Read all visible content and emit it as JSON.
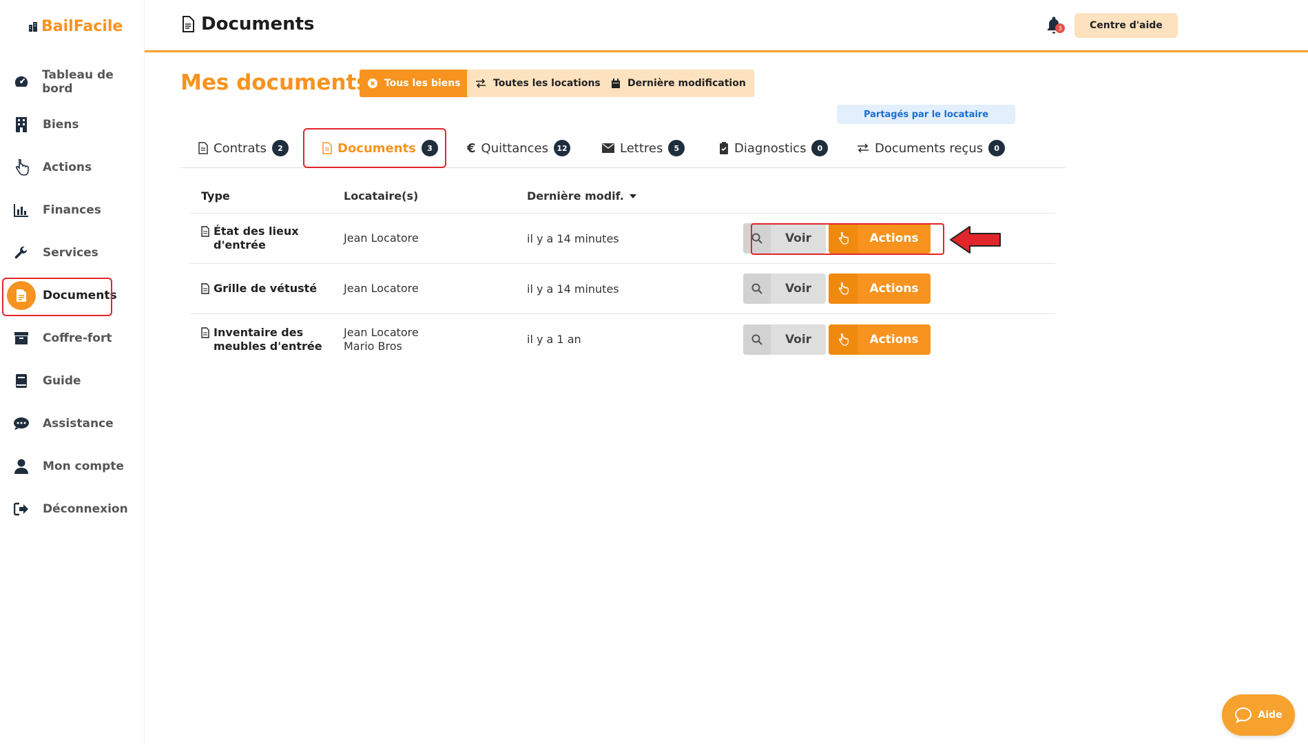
{
  "app": {
    "logo": "BailFacile"
  },
  "colors": {
    "accent": "#f7931e",
    "annotation": "#e0252b",
    "badge": "#1f2d3d"
  },
  "sidebar": {
    "items": [
      {
        "label": "Tableau de bord",
        "icon": "dashboard-icon"
      },
      {
        "label": "Biens",
        "icon": "building-icon"
      },
      {
        "label": "Actions",
        "icon": "hand-pointer-icon"
      },
      {
        "label": "Finances",
        "icon": "bar-chart-icon"
      },
      {
        "label": "Services",
        "icon": "wrench-icon"
      },
      {
        "label": "Documents",
        "icon": "document-icon",
        "active": true
      },
      {
        "label": "Coffre-fort",
        "icon": "archive-box-icon"
      },
      {
        "label": "Guide",
        "icon": "book-icon"
      },
      {
        "label": "Assistance",
        "icon": "chat-icon"
      },
      {
        "label": "Mon compte",
        "icon": "user-icon"
      },
      {
        "label": "Déconnexion",
        "icon": "logout-icon"
      }
    ]
  },
  "header": {
    "title": "Documents",
    "help_center": "Centre d'aide",
    "notifications_count": "3"
  },
  "main": {
    "title": "Mes documents",
    "filters": [
      {
        "label": "Tous les biens",
        "icon": "close-circle-icon"
      },
      {
        "label": "Toutes les locations",
        "icon": "swap-icon"
      },
      {
        "label": "Dernière modification",
        "icon": "calendar-icon"
      }
    ],
    "shared_tag": "Partagés par le locataire",
    "tabs": [
      {
        "label": "Contrats",
        "count": "2",
        "icon": "document-icon"
      },
      {
        "label": "Documents",
        "count": "3",
        "icon": "document-icon",
        "active": true
      },
      {
        "label": "Quittances",
        "count": "12",
        "icon": "euro-icon"
      },
      {
        "label": "Lettres",
        "count": "5",
        "icon": "envelope-icon"
      },
      {
        "label": "Diagnostics",
        "count": "0",
        "icon": "clipboard-check-icon"
      },
      {
        "label": "Documents reçus",
        "count": "0",
        "icon": "swap-icon"
      }
    ],
    "table": {
      "headers": {
        "type": "Type",
        "tenants": "Locataire(s)",
        "modified": "Dernière modif."
      },
      "rows": [
        {
          "type_line1": "État des lieux",
          "type_line2": "d'entrée",
          "tenant1": "Jean Locatore",
          "tenant2": "",
          "modified": "il y a 14 minutes"
        },
        {
          "type_line1": "Grille de vétusté",
          "type_line2": "",
          "tenant1": "Jean Locatore",
          "tenant2": "",
          "modified": "il y a 14 minutes"
        },
        {
          "type_line1": "Inventaire des",
          "type_line2": "meubles d'entrée",
          "tenant1": "Jean Locatore",
          "tenant2": "Mario Bros",
          "modified": "il y a 1 an"
        }
      ],
      "view_label": "Voir",
      "actions_label": "Actions"
    }
  },
  "help_bubble": {
    "label": "Aide"
  }
}
